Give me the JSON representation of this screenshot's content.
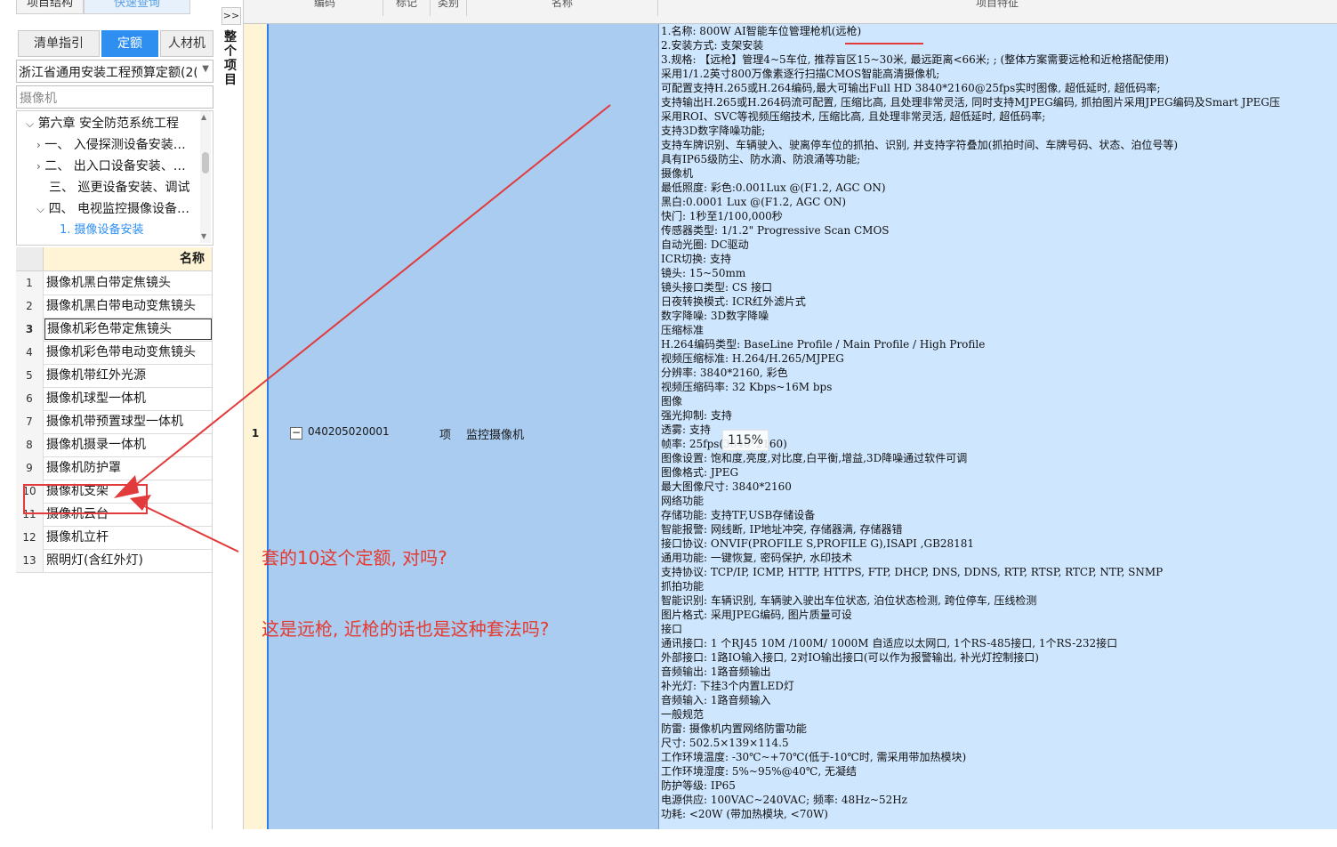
{
  "left_panel": {
    "top_tabs": [
      "项目结构",
      "快速查询"
    ],
    "subtabs": [
      "清单指引",
      "定额",
      "人材机"
    ],
    "quota_library": "浙江省通用安装工程预算定额(2(",
    "search_value": "摄像机",
    "tree": [
      {
        "toggle": "⌵",
        "text": "第六章  安全防范系统工程"
      },
      {
        "toggle": "›",
        "text": "一、  入侵探测设备安装…"
      },
      {
        "toggle": "›",
        "text": "二、  出入口设备安装、…"
      },
      {
        "toggle": "",
        "text": "三、  巡更设备安装、调试"
      },
      {
        "toggle": "⌵",
        "text": "四、  电视监控摄像设备…"
      },
      {
        "toggle": "",
        "text": "1.  摄像设备安装"
      }
    ],
    "list_header": "名称",
    "list_items": [
      {
        "n": "1",
        "name": "摄像机黑白带定焦镜头"
      },
      {
        "n": "2",
        "name": "摄像机黑白带电动变焦镜头"
      },
      {
        "n": "3",
        "name": "摄像机彩色带定焦镜头"
      },
      {
        "n": "4",
        "name": "摄像机彩色带电动变焦镜头"
      },
      {
        "n": "5",
        "name": "摄像机带红外光源"
      },
      {
        "n": "6",
        "name": "摄像机球型一体机"
      },
      {
        "n": "7",
        "name": "摄像机带预置球型一体机"
      },
      {
        "n": "8",
        "name": "摄像机摄录一体机"
      },
      {
        "n": "9",
        "name": "摄像机防护罩"
      },
      {
        "n": "10",
        "name": "摄像机支架"
      },
      {
        "n": "11",
        "name": "摄像机云台"
      },
      {
        "n": "12",
        "name": "摄像机立杆"
      },
      {
        "n": "13",
        "name": "照明灯(含红外灯)"
      }
    ]
  },
  "middle": {
    "expand_btn": ">>",
    "vertical_label": "整个项目"
  },
  "table": {
    "headers": [
      "编码",
      "标记",
      "类别",
      "名称",
      "项目特征"
    ],
    "row": {
      "num": "1",
      "code": "040205020001",
      "type": "项",
      "name": "监控摄像机"
    },
    "features": [
      "1.名称: 800W AI智能车位管理枪机(远枪)",
      "2.安装方式: 支架安装",
      "3.规格: 【远枪】管理4~5车位, 推荐盲区15~30米, 最远距离<66米; ; (整体方案需要远枪和近枪搭配使用)",
      "采用1/1.2英寸800万像素逐行扫描CMOS智能高清摄像机;",
      "可配置支持H.265或H.264编码,最大可输出Full HD 3840*2160@25fps实时图像, 超低延时, 超低码率;",
      "支持输出H.265或H.264码流可配置, 压缩比高, 且处理非常灵活, 同时支持MJPEG编码, 抓拍图片采用JPEG编码及Smart JPEG压",
      "采用ROI、SVC等视频压缩技术, 压缩比高, 且处理非常灵活,  超低延时, 超低码率;",
      "支持3D数字降噪功能;",
      "支持车牌识别、车辆驶入、驶离停车位的抓拍、识别, 并支持字符叠加(抓拍时间、车牌号码、状态、泊位号等)",
      "具有IP65级防尘、防水滴、防浪涌等功能;",
      "摄像机",
      "最低照度: 彩色:0.001Lux @(F1.2, AGC ON)",
      "黑白:0.0001 Lux @(F1.2, AGC ON)",
      "快门: 1秒至1/100,000秒",
      "传感器类型: 1/1.2\" Progressive Scan CMOS",
      "自动光圈: DC驱动",
      "ICR切换: 支持",
      "镜头: 15~50mm",
      "镜头接口类型: CS 接口",
      "日夜转换模式: ICR红外滤片式",
      "数字降噪: 3D数字降噪",
      "压缩标准",
      "H.264编码类型: BaseLine Profile / Main Profile / High Profile",
      "视频压缩标准: H.264/H.265/MJPEG",
      "分辨率: 3840*2160, 彩色",
      "视频压缩码率: 32 Kbps~16M bps",
      "图像",
      "强光抑制: 支持",
      "透雾: 支持",
      "帧率: 25fps(3840*2160)",
      "图像设置: 饱和度,亮度,对比度,白平衡,增益,3D降噪通过软件可调",
      "图像格式: JPEG",
      "最大图像尺寸: 3840*2160",
      "网络功能",
      "存储功能: 支持TF,USB存储设备",
      "智能报警: 网线断, IP地址冲突, 存储器满, 存储器错",
      "接口协议: ONVIF(PROFILE S,PROFILE G),ISAPI ,GB28181",
      "通用功能: 一键恢复, 密码保护, 水印技术",
      "支持协议: TCP/IP, ICMP, HTTP, HTTPS, FTP, DHCP, DNS, DDNS, RTP, RTSP, RTCP, NTP,  SNMP",
      "抓拍功能",
      "智能识别: 车辆识别, 车辆驶入驶出车位状态, 泊位状态检测, 跨位停车, 压线检测",
      "图片格式: 采用JPEG编码, 图片质量可设",
      "接口",
      "通讯接口: 1 个RJ45 10M /100M/ 1000M 自适应以太网口, 1个RS-485接口, 1个RS-232接口",
      "外部接口: 1路IO输入接口, 2对IO输出接口(可以作为报警输出, 补光灯控制接口)",
      "音频输出: 1路音频输出",
      "补光灯: 下挂3个内置LED灯",
      "音频输入: 1路音频输入",
      "一般规范",
      "防雷: 摄像机内置网络防雷功能",
      "尺寸: 502.5×139×114.5",
      "工作环境温度: -30℃~+70℃(低于-10℃时, 需采用带加热模块)",
      "工作环境湿度: 5%~95%@40℃, 无凝结",
      "防护等级: IP65",
      "电源供应: 100VAC~240VAC; 频率: 48Hz~52Hz",
      "功耗: <20W (带加热模块, <70W)"
    ],
    "zoom": "115%"
  },
  "annotations": {
    "q1": "套的10这个定额, 对吗?",
    "q2": "这是远枪, 近枪的话也是这种套法吗?",
    "color": "#e6392f"
  }
}
